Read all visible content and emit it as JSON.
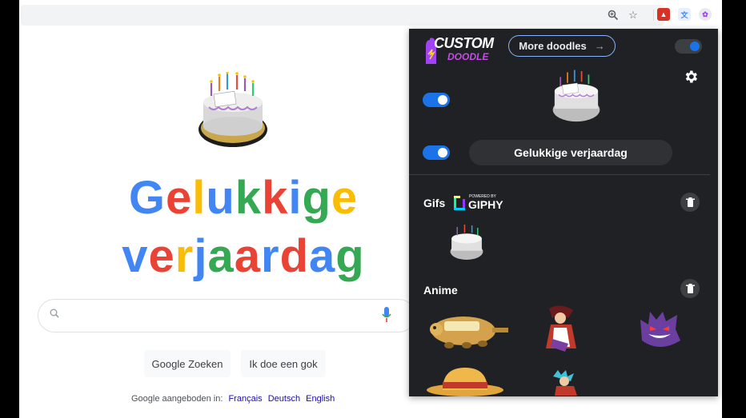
{
  "browser": {
    "toolbar_icons": [
      "zoom-icon",
      "star-icon"
    ],
    "extensions": [
      {
        "name": "pdf-extension-icon",
        "color": "#d93025"
      },
      {
        "name": "translate-extension-icon",
        "color": "#4285f4"
      },
      {
        "name": "custom-doodle-extension-icon",
        "color": "#a142f4"
      }
    ]
  },
  "google": {
    "headline_line1": [
      "G",
      "e",
      "l",
      "u",
      "k",
      "k",
      "i",
      "g",
      "e"
    ],
    "headline_line2": [
      "v",
      "e",
      "r",
      "j",
      "a",
      "a",
      "r",
      "d",
      "a",
      "g"
    ],
    "colors_line1": [
      "#4285f4",
      "#ea4335",
      "#fbbc05",
      "#4285f4",
      "#34a853",
      "#ea4335",
      "#4285f4",
      "#34a853",
      "#fbbc05"
    ],
    "colors_line2": [
      "#4285f4",
      "#ea4335",
      "#fbbc05",
      "#4285f4",
      "#34a853",
      "#ea4335",
      "#4285f4",
      "#ea4335",
      "#4285f4",
      "#34a853"
    ],
    "search_placeholder": "",
    "buttons": {
      "search": "Google Zoeken",
      "lucky": "Ik doe een gok"
    },
    "offered_in_label": "Google aangeboden in:",
    "languages": [
      "Français",
      "Deutsch",
      "English"
    ]
  },
  "popup": {
    "logo_line1": "CUSTOM",
    "logo_line2": "DOODLE",
    "more_doodles_label": "More doodles",
    "more_doodles_arrow": "→",
    "main_toggle_on": true,
    "image_toggle_on": true,
    "text_toggle_on": true,
    "doodle_text": "Gelukkige verjaardag",
    "sections": [
      {
        "title": "Gifs",
        "powered_by": "POWERED BY",
        "brand": "GIPHY"
      },
      {
        "title": "Anime"
      }
    ],
    "accent": "#1a73e8"
  }
}
